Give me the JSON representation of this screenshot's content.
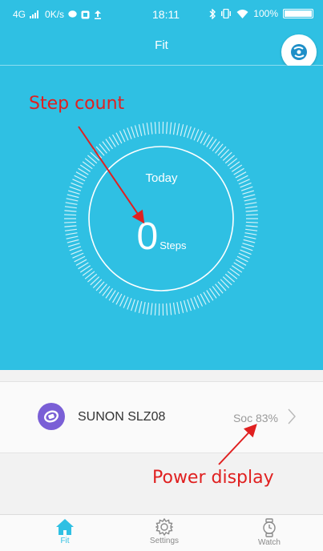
{
  "status_bar": {
    "network": "4G",
    "speed": "0K/s",
    "time": "18:11",
    "battery": "100%",
    "battery_level": 1.0
  },
  "header": {
    "title": "Fit"
  },
  "main": {
    "today_label": "Today",
    "step_value": "0",
    "step_unit": "Steps"
  },
  "device": {
    "name": "SUNON SLZ08",
    "soc": "Soc 83%"
  },
  "annotations": {
    "step_count": "Step count",
    "power_display": "Power display"
  },
  "nav": {
    "items": [
      {
        "label": "Fit",
        "icon": "home-icon",
        "active": true
      },
      {
        "label": "Settings",
        "icon": "gear-icon",
        "active": false
      },
      {
        "label": "Watch",
        "icon": "watch-icon",
        "active": false
      }
    ]
  },
  "colors": {
    "accent": "#2fc0e3",
    "annotation": "#e02020",
    "device_avatar": "#7a5fd6"
  }
}
